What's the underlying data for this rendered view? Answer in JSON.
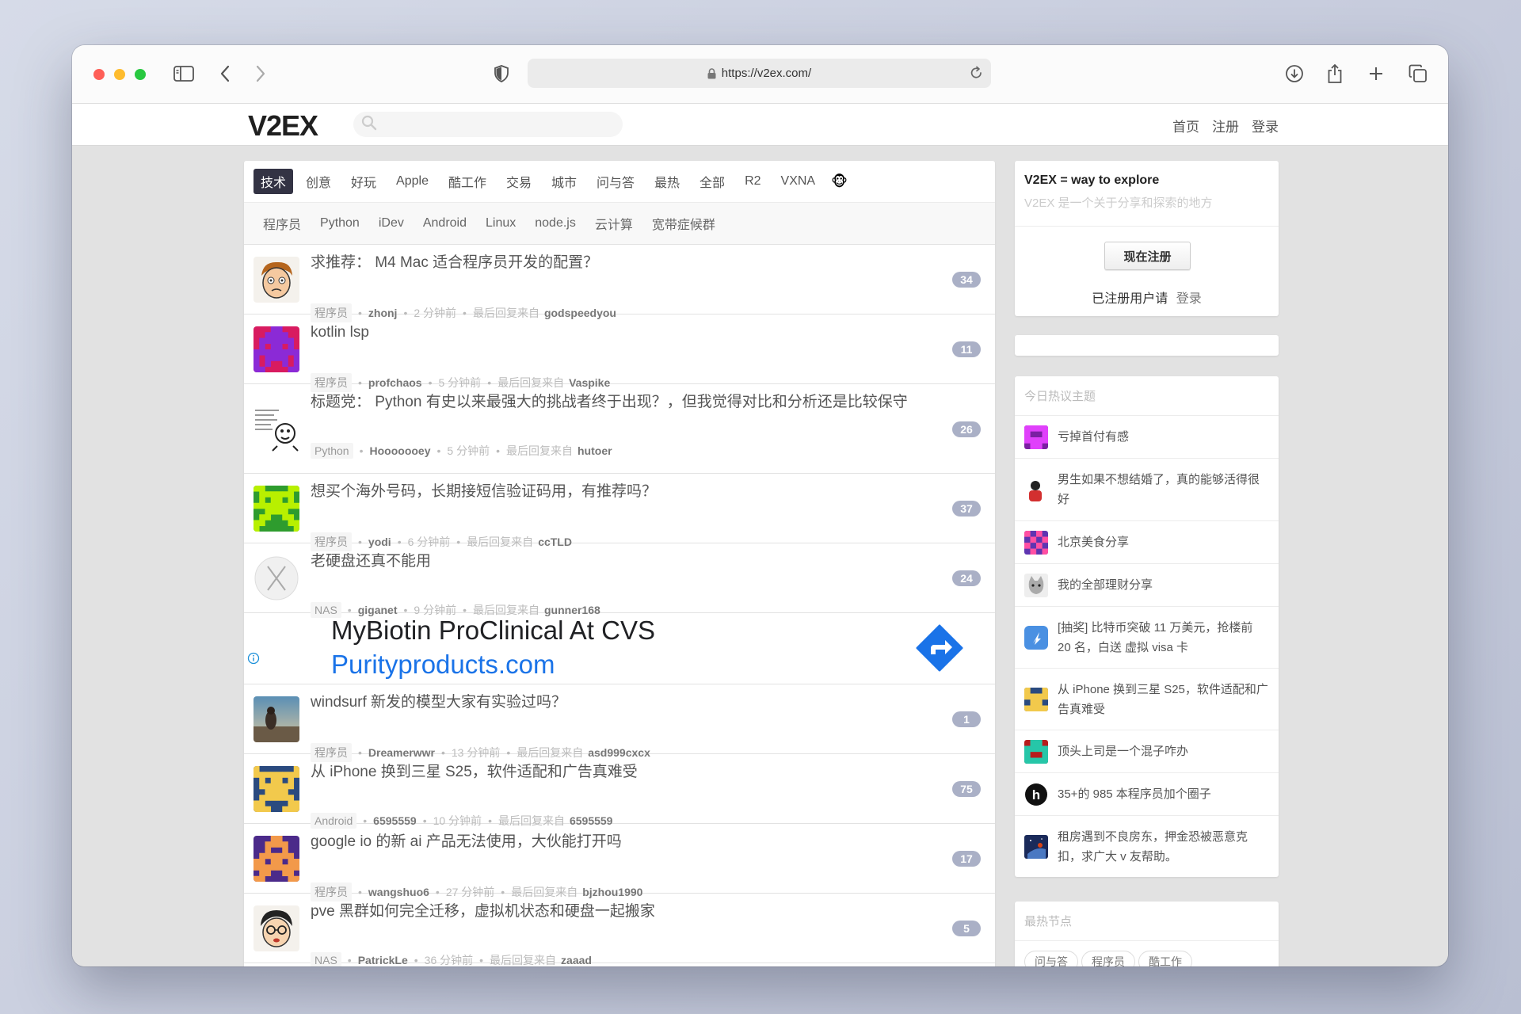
{
  "browser": {
    "url": "https://v2ex.com/"
  },
  "site": {
    "logo": "V2EX",
    "search_placeholder": "",
    "nav": [
      "首页",
      "注册",
      "登录"
    ]
  },
  "tabs": {
    "items": [
      "技术",
      "创意",
      "好玩",
      "Apple",
      "酷工作",
      "交易",
      "城市",
      "问与答",
      "最热",
      "全部",
      "R2",
      "VXNA"
    ],
    "active": "技术",
    "emoji": "🐵"
  },
  "subtabs": [
    "程序员",
    "Python",
    "iDev",
    "Android",
    "Linux",
    "node.js",
    "云计算",
    "宽带症候群"
  ],
  "topics": [
    {
      "title": "求推荐： M4 Mac 适合程序员开发的配置？",
      "node": "程序员",
      "author": "zhonj",
      "time": "2 分钟前",
      "reply_label": "最后回复来自",
      "last_reply": "godspeedyou",
      "count": "34",
      "avatar": "face-orange"
    },
    {
      "title": "kotlin lsp",
      "node": "程序员",
      "author": "profchaos",
      "time": "5 分钟前",
      "reply_label": "最后回复来自",
      "last_reply": "Vaspike",
      "count": "11",
      "avatar": "pixel-purple"
    },
    {
      "title": "标题党： Python 有史以来最强大的挑战者终于出现？，但我觉得对比和分析还是比较保守",
      "node": "Python",
      "author": "Hooooooey",
      "time": "5 分钟前",
      "reply_label": "最后回复来自",
      "last_reply": "hutoer",
      "count": "26",
      "avatar": "meme"
    },
    {
      "title": "想买个海外号码，长期接短信验证码用，有推荐吗？",
      "node": "程序员",
      "author": "yodi",
      "time": "6 分钟前",
      "reply_label": "最后回复来自",
      "last_reply": "ccTLD",
      "count": "37",
      "avatar": "pixel-green"
    },
    {
      "title": "老硬盘还真不能用",
      "node": "NAS",
      "author": "giganet",
      "time": "9 分钟前",
      "reply_label": "最后回复来自",
      "last_reply": "gunner168",
      "count": "24",
      "avatar": "macx"
    }
  ],
  "ad": {
    "line1": "MyBiotin ProClinical At CVS",
    "line2": "Purityproducts.com"
  },
  "topics2": [
    {
      "title": "windsurf 新发的模型大家有实验过吗？",
      "node": "程序员",
      "author": "Dreamerwwr",
      "time": "13 分钟前",
      "reply_label": "最后回复来自",
      "last_reply": "asd999cxcx",
      "count": "1",
      "avatar": "photo"
    },
    {
      "title": "从 iPhone 换到三星 S25，软件适配和广告真难受",
      "node": "Android",
      "author": "6595559",
      "time": "10 分钟前",
      "reply_label": "最后回复来自",
      "last_reply": "6595559",
      "count": "75",
      "avatar": "pixel-navy"
    },
    {
      "title": "google io 的新 ai 产品无法使用，大伙能打开吗",
      "node": "程序员",
      "author": "wangshuo6",
      "time": "27 分钟前",
      "reply_label": "最后回复来自",
      "last_reply": "bjzhou1990",
      "count": "17",
      "avatar": "pixel-orange"
    },
    {
      "title": "pve 黑群如何完全迁移，虚拟机状态和硬盘一起搬家",
      "node": "NAS",
      "author": "PatrickLe",
      "time": "36 分钟前",
      "reply_label": "最后回复来自",
      "last_reply": "zaaad",
      "count": "5",
      "avatar": "face-glasses"
    }
  ],
  "sidebar": {
    "intro_title": "V2EX = way to explore",
    "intro_sub": "V2EX 是一个关于分享和探索的地方",
    "signup_button": "现在注册",
    "login_prompt": "已注册用户请",
    "login_link": "登录",
    "hot_title": "今日热议主题",
    "hot": [
      {
        "text": "亏掉首付有感",
        "avatar": "pix-magenta"
      },
      {
        "text": "男生如果不想结婚了，真的能够活得很好",
        "avatar": "person"
      },
      {
        "text": "北京美食分享",
        "avatar": "pix-pink"
      },
      {
        "text": "我的全部理财分享",
        "avatar": "cat"
      },
      {
        "text": "[抽奖] 比特币突破 11 万美元，抢楼前 20 名，白送 虚拟 visa 卡",
        "avatar": "blue-app"
      },
      {
        "text": "从 iPhone 换到三星 S25，软件适配和广告真难受",
        "avatar": "pix-navy"
      },
      {
        "text": "顶头上司是一个混子咋办",
        "avatar": "pix-teal"
      },
      {
        "text": "35+的 985 本程序员加个圈子",
        "avatar": "h-logo"
      },
      {
        "text": "租房遇到不良房东，押金恐被恶意克扣，求广大 v 友帮助。",
        "avatar": "space"
      }
    ],
    "hot_nodes_title": "最热节点",
    "hot_nodes": [
      "问与答",
      "程序员",
      "酷工作"
    ]
  }
}
